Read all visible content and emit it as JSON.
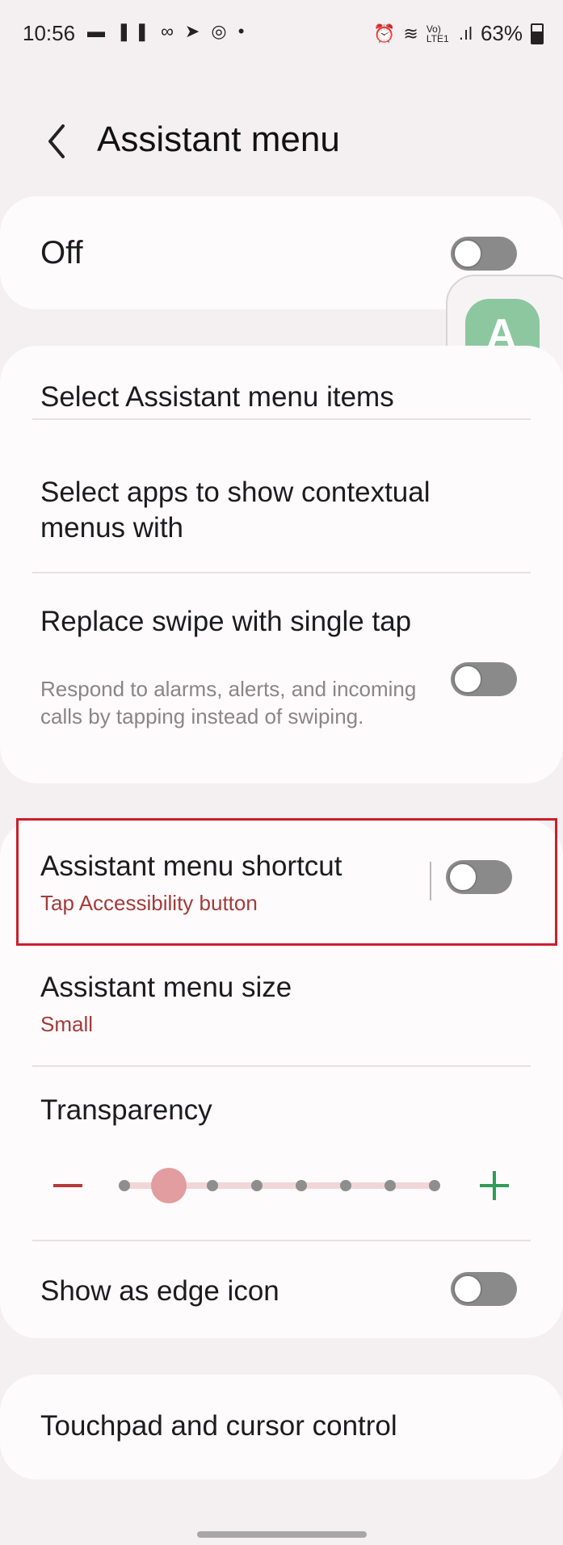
{
  "status_bar": {
    "time": "10:56",
    "left_icons": "▬ ❚❚ ∞ ➤ ◎ •",
    "alarm": "⏰",
    "wifi": "≋",
    "network": "Vo) LTE1",
    "signal": ".ıl",
    "battery": "63%"
  },
  "header": {
    "title": "Assistant menu"
  },
  "main_switch": {
    "label": "Off",
    "on": false
  },
  "items": {
    "select_items": "Select Assistant menu items",
    "select_apps": "Select apps to show contextual menus with",
    "replace_swipe_title": "Replace swipe with single tap",
    "replace_swipe_desc": "Respond to alarms, alerts, and incoming calls by tapping instead of swiping.",
    "shortcut_title": "Assistant menu shortcut",
    "shortcut_sub": "Tap Accessibility button",
    "size_title": "Assistant menu size",
    "size_value": "Small",
    "transparency_title": "Transparency",
    "transparency_level": 1,
    "transparency_steps": 8,
    "edge_icon_title": "Show as edge icon",
    "touchpad_title": "Touchpad and cursor control"
  },
  "floating_menu": {
    "top_letter": "A",
    "accent_top": "#8dc7a0",
    "accent_bottom": "#8fcfc9"
  },
  "colors": {
    "accent_red": "#a33b3b",
    "highlight": "#c8202e",
    "plus_green": "#2e9d57"
  }
}
